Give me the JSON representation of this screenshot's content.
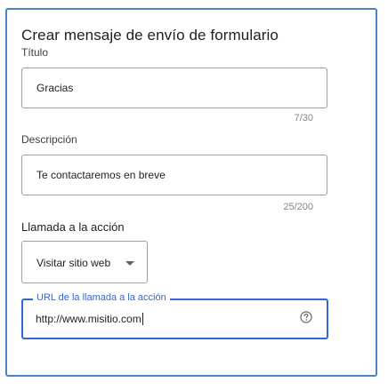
{
  "form": {
    "heading": "Crear mensaje de envío de formulario",
    "title_field": {
      "label": "Título",
      "value": "Gracias",
      "counter": "7/30"
    },
    "description_field": {
      "label": "Descripción",
      "value": "Te contactaremos en breve",
      "counter": "25/200"
    },
    "cta_field": {
      "label": "Llamada a la acción",
      "selected": "Visitar sitio web"
    },
    "url_field": {
      "label": "URL de la llamada a la acción",
      "value": "http://www.misitio.com"
    }
  },
  "icons": {
    "dropdown": "chevron-down-icon",
    "help": "help-circle-icon"
  },
  "colors": {
    "panel_border": "#4b83c6",
    "focus_accent": "#3367d6",
    "text_primary": "#202124",
    "text_muted": "#80868b"
  }
}
